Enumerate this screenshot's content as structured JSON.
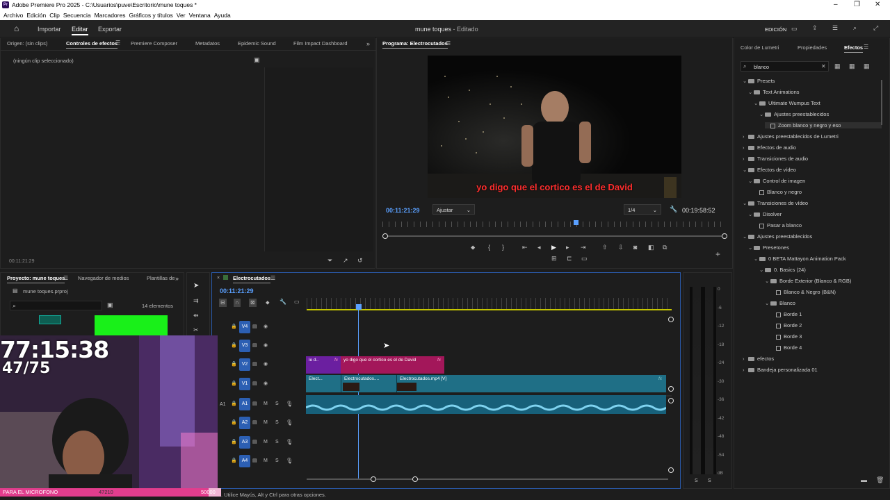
{
  "app": {
    "title": "Adobe Premiere Pro 2025 - C:\\Usuarios\\puve\\Escritorio\\mune toques *",
    "logo": "Pr",
    "menu": [
      "Archivo",
      "Edición",
      "Clip",
      "Secuencia",
      "Marcadores",
      "Gráficos y títulos",
      "Ver",
      "Ventana",
      "Ayuda"
    ]
  },
  "header": {
    "nav": [
      "Importar",
      "Editar",
      "Exportar"
    ],
    "active": "Editar",
    "project_title": "mune toques",
    "project_status": " - Editado",
    "workspace": "EDICIÓN"
  },
  "source_panel": {
    "tabs": [
      "Origen: (sin clips)",
      "Controles de efectos",
      "Premiere Composer",
      "Metadatos",
      "Epidemic Sound",
      "Film Impact Dashboard"
    ],
    "active_tab": "Controles de efectos",
    "empty_label": "(ningún clip seleccionado)",
    "timecode": "00:11:21:29"
  },
  "program": {
    "title": "Programa: Electrocutados",
    "caption": "yo digo que el cortico es el de David",
    "timecode": "00:11:21:29",
    "fit": "Ajustar",
    "resolution": "1/4",
    "duration": "00:19:58:52"
  },
  "right_panel": {
    "tabs": [
      "Color de Lumetri",
      "Propiedades",
      "Efectos"
    ],
    "active_tab": "Efectos",
    "search_value": "blanco",
    "tree": [
      {
        "label": "Presets",
        "depth": 0,
        "type": "folder",
        "arrow": "v"
      },
      {
        "label": "Text Animations",
        "depth": 1,
        "type": "folder",
        "arrow": "v"
      },
      {
        "label": "Ultimate Wumpus Text",
        "depth": 2,
        "type": "folder",
        "arrow": "v"
      },
      {
        "label": "Ajustes preestablecidos",
        "depth": 3,
        "type": "folder",
        "arrow": "v"
      },
      {
        "label": "Zoom blanco y negro y eso",
        "depth": 4,
        "type": "effect",
        "arrow": "",
        "selected": true
      },
      {
        "label": "Ajustes preestablecidos de Lumetri",
        "depth": 0,
        "type": "folder",
        "arrow": ">"
      },
      {
        "label": "Efectos de audio",
        "depth": 0,
        "type": "folder",
        "arrow": ">"
      },
      {
        "label": "Transiciones de audio",
        "depth": 0,
        "type": "folder",
        "arrow": ">"
      },
      {
        "label": "Efectos de vídeo",
        "depth": 0,
        "type": "folder",
        "arrow": "v"
      },
      {
        "label": "Control de imagen",
        "depth": 1,
        "type": "folder",
        "arrow": "v"
      },
      {
        "label": "Blanco y negro",
        "depth": 2,
        "type": "effect",
        "arrow": ""
      },
      {
        "label": "Transiciones de vídeo",
        "depth": 0,
        "type": "folder",
        "arrow": "v"
      },
      {
        "label": "Disolver",
        "depth": 1,
        "type": "folder",
        "arrow": "v"
      },
      {
        "label": "Pasar a blanco",
        "depth": 2,
        "type": "effect",
        "arrow": ""
      },
      {
        "label": "Ajustes preestablecidos",
        "depth": 0,
        "type": "folder",
        "arrow": "v"
      },
      {
        "label": "Presetones",
        "depth": 1,
        "type": "folder",
        "arrow": "v"
      },
      {
        "label": "0 BETA Mattayon Animation Pack",
        "depth": 2,
        "type": "folder",
        "arrow": "v"
      },
      {
        "label": "0. Basics (24)",
        "depth": 3,
        "type": "folder",
        "arrow": "v"
      },
      {
        "label": "Borde Exterior (Blanco & RGB)",
        "depth": 4,
        "type": "folder",
        "arrow": "v"
      },
      {
        "label": "Blanco & Negro (B&N)",
        "depth": 5,
        "type": "effect",
        "arrow": ""
      },
      {
        "label": "Blanco",
        "depth": 4,
        "type": "folder",
        "arrow": "v"
      },
      {
        "label": "Borde 1",
        "depth": 5,
        "type": "effect",
        "arrow": ""
      },
      {
        "label": "Borde 2",
        "depth": 5,
        "type": "effect",
        "arrow": ""
      },
      {
        "label": "Borde 3",
        "depth": 5,
        "type": "effect",
        "arrow": ""
      },
      {
        "label": "Borde 4",
        "depth": 5,
        "type": "effect",
        "arrow": ""
      },
      {
        "label": "efectos",
        "depth": 0,
        "type": "folder",
        "arrow": ">"
      },
      {
        "label": "Bandeja personalizada 01",
        "depth": 0,
        "type": "folder",
        "arrow": ">"
      }
    ]
  },
  "project_panel": {
    "tabs": [
      "Proyecto: mune toques",
      "Navegador de medios",
      "Plantillas de"
    ],
    "file": "mune toques.prproj",
    "count": "14 elementos"
  },
  "timeline": {
    "sequence": "Electrocutados",
    "timecode": "00:11:21:29",
    "tracks": [
      "V4",
      "V3",
      "V2",
      "V1",
      "A1",
      "A2",
      "A3",
      "A4"
    ],
    "source_patch": "A1",
    "clips": {
      "v2_a": "le d..",
      "v2_b": "yo digo que el cortico es el de David",
      "v1_a": "Elect...",
      "v1_b": "Electrocutados....",
      "v1_c": "Electrocutados.mp4 [V]"
    }
  },
  "meters": {
    "scale": [
      "0",
      "-6",
      "-12",
      "-18",
      "-24",
      "-30",
      "-36",
      "-42",
      "-48",
      "-54",
      "dB"
    ],
    "solo": [
      "S",
      "S"
    ]
  },
  "overlay": {
    "timer": "77:15:38",
    "counter": "47/75",
    "bar_label": "PARA EL MICROFONO",
    "bar_value": "47210",
    "bar_goal": "50000",
    "bar_progress": 0.944
  },
  "status": {
    "hint": ". Utilice Mayús, Alt y Ctrl para otras opciones."
  },
  "colors": {
    "accent": "#2c5fb3",
    "v1_clip": "#1f6f86",
    "v2_clip": "#a3175a",
    "v2_clip_purple": "#6b1fa0",
    "audio_clip": "#17607a",
    "overlay_bar": "#e23d8d",
    "green_screen": "#19f019"
  }
}
